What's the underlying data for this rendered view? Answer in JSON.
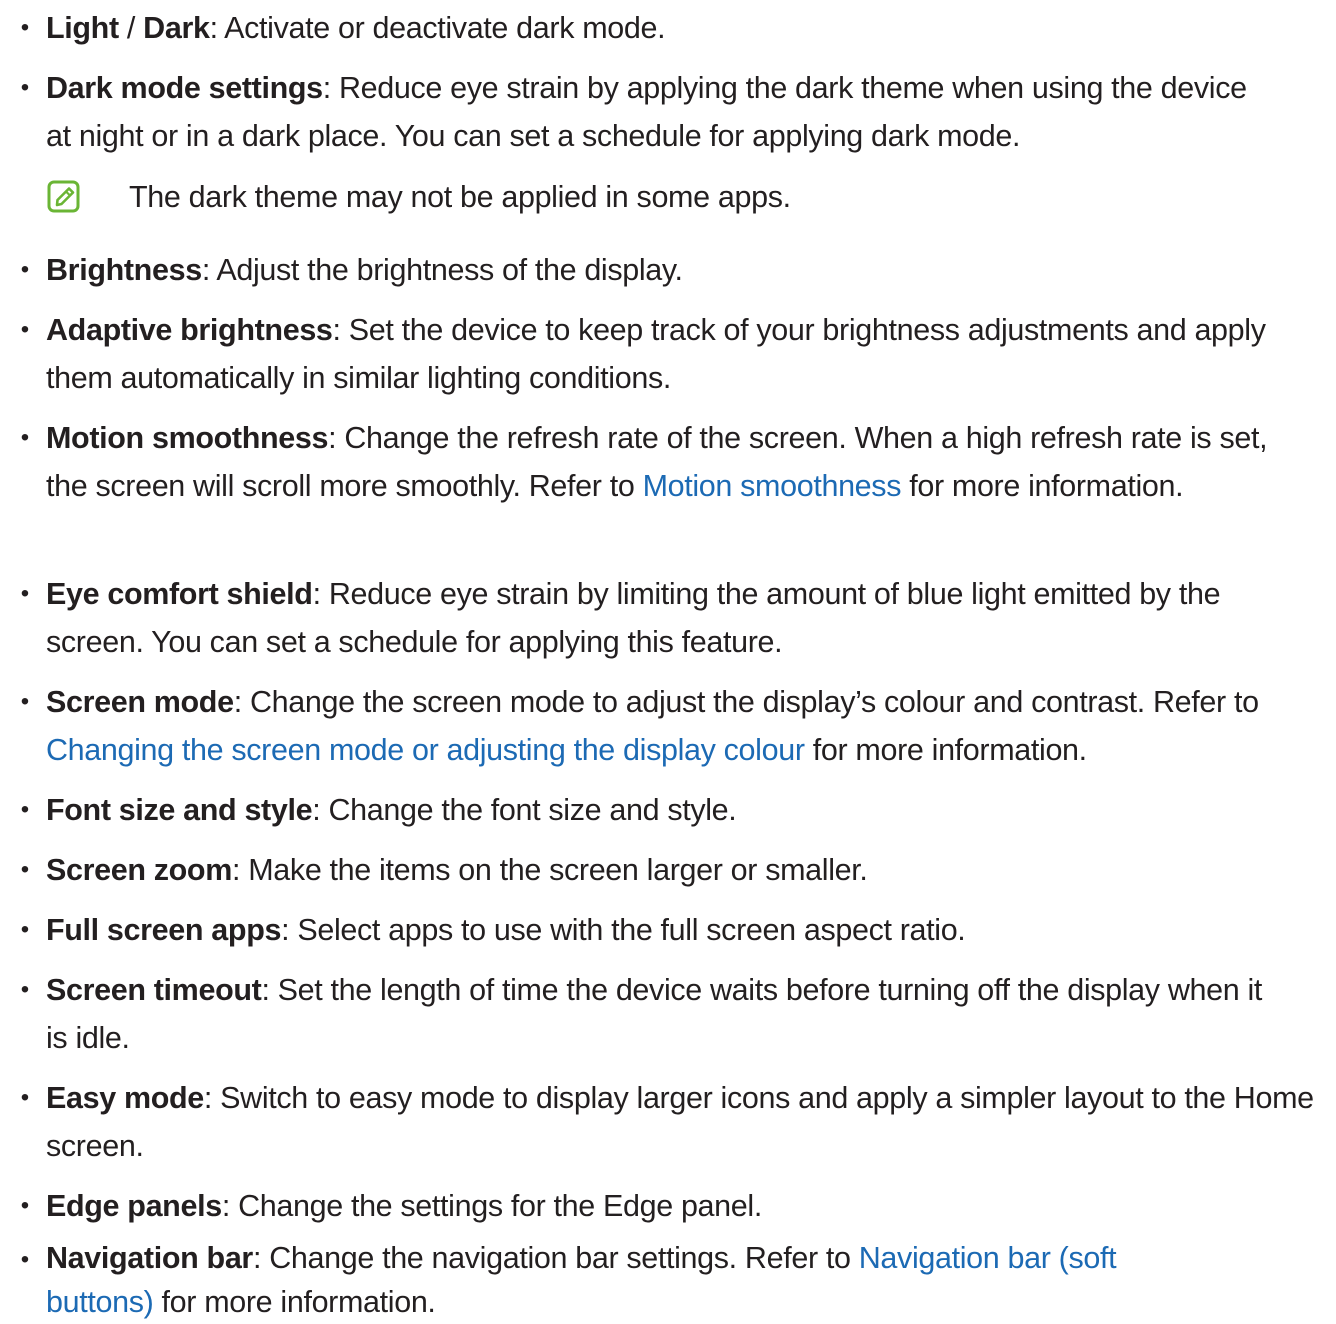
{
  "bullet_char": "•",
  "note_text": "The dark theme may not be applied in some apps.",
  "note_icon": "note-pencil-icon",
  "colors": {
    "text": "#231f20",
    "link": "#1c6ab4",
    "icon": "#6ab535"
  },
  "items": [
    {
      "term": "Light",
      "sep": " / ",
      "term2": "Dark",
      "rest": ": Activate or deactivate dark mode."
    },
    {
      "term": "Dark mode settings",
      "rest": ": Reduce eye strain by applying the dark theme when using the device at night or in a dark place. You can set a schedule for applying dark mode."
    },
    {
      "term": "Brightness",
      "rest": ": Adjust the brightness of the display."
    },
    {
      "term": "Adaptive brightness",
      "rest": ": Set the device to keep track of your brightness adjustments and apply them automatically in similar lighting conditions."
    },
    {
      "term": "Motion smoothness",
      "rest": ": Change the refresh rate of the screen. When a high refresh rate is set, the screen will scroll more smoothly. Refer to ",
      "link": "Motion smoothness",
      "after": " for more information."
    },
    {
      "term": "Eye comfort shield",
      "rest": ": Reduce eye strain by limiting the amount of blue light emitted by the screen. You can set a schedule for applying this feature."
    },
    {
      "term": "Screen mode",
      "rest": ": Change the screen mode to adjust the display’s colour and contrast. Refer to ",
      "link": "Changing the screen mode or adjusting the display colour",
      "after": " for more information."
    },
    {
      "term": "Font size and style",
      "rest": ": Change the font size and style."
    },
    {
      "term": "Screen zoom",
      "rest": ": Make the items on the screen larger or smaller."
    },
    {
      "term": "Full screen apps",
      "rest": ": Select apps to use with the full screen aspect ratio."
    },
    {
      "term": "Screen timeout",
      "rest": ": Set the length of time the device waits before turning off the display when it is idle."
    },
    {
      "term": "Easy mode",
      "rest": ": Switch to easy mode to display larger icons and apply a simpler layout to the Home screen."
    },
    {
      "term": "Edge panels",
      "rest": ": Change the settings for the Edge panel."
    },
    {
      "term": "Navigation bar",
      "rest": ": Change the navigation bar settings. Refer to ",
      "link": "Navigation bar (soft buttons)",
      "after": " for more information."
    }
  ]
}
